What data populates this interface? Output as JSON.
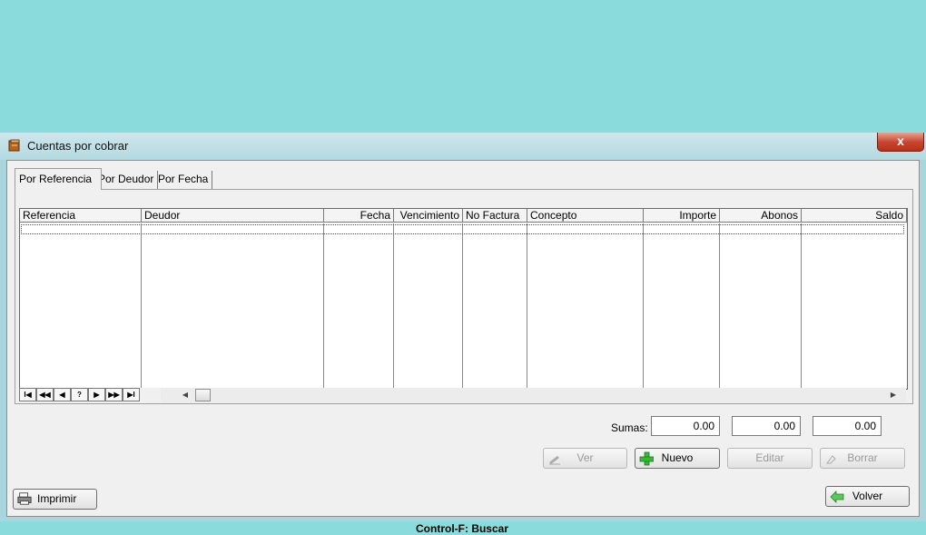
{
  "window": {
    "title": "Cuentas por cobrar",
    "close_label": "x"
  },
  "tabs": [
    {
      "label": "Por Referencia"
    },
    {
      "label": "Por Deudor"
    },
    {
      "label": "Por Fecha"
    }
  ],
  "grid": {
    "columns": [
      {
        "label": "Referencia"
      },
      {
        "label": "Deudor"
      },
      {
        "label": "Fecha"
      },
      {
        "label": "Vencimiento"
      },
      {
        "label": "No Factura"
      },
      {
        "label": "Concepto"
      },
      {
        "label": "Importe"
      },
      {
        "label": "Abonos"
      },
      {
        "label": "Saldo"
      }
    ]
  },
  "navigator": {
    "first": "I◀",
    "prev_page": "◀◀",
    "prev": "◀",
    "help": "?",
    "next": "▶",
    "next_page": "▶▶",
    "last": "▶I"
  },
  "scroll": {
    "left_arrow": "◀",
    "right_arrow": "▶"
  },
  "sums": {
    "label": "Sumas:",
    "importe": "0.00",
    "abonos": "0.00",
    "saldo": "0.00"
  },
  "actions": {
    "ver": "Ver",
    "nuevo": "Nuevo",
    "editar": "Editar",
    "borrar": "Borrar"
  },
  "footer": {
    "imprimir": "Imprimir",
    "hint": "Control-F: Buscar",
    "volver": "Volver"
  }
}
